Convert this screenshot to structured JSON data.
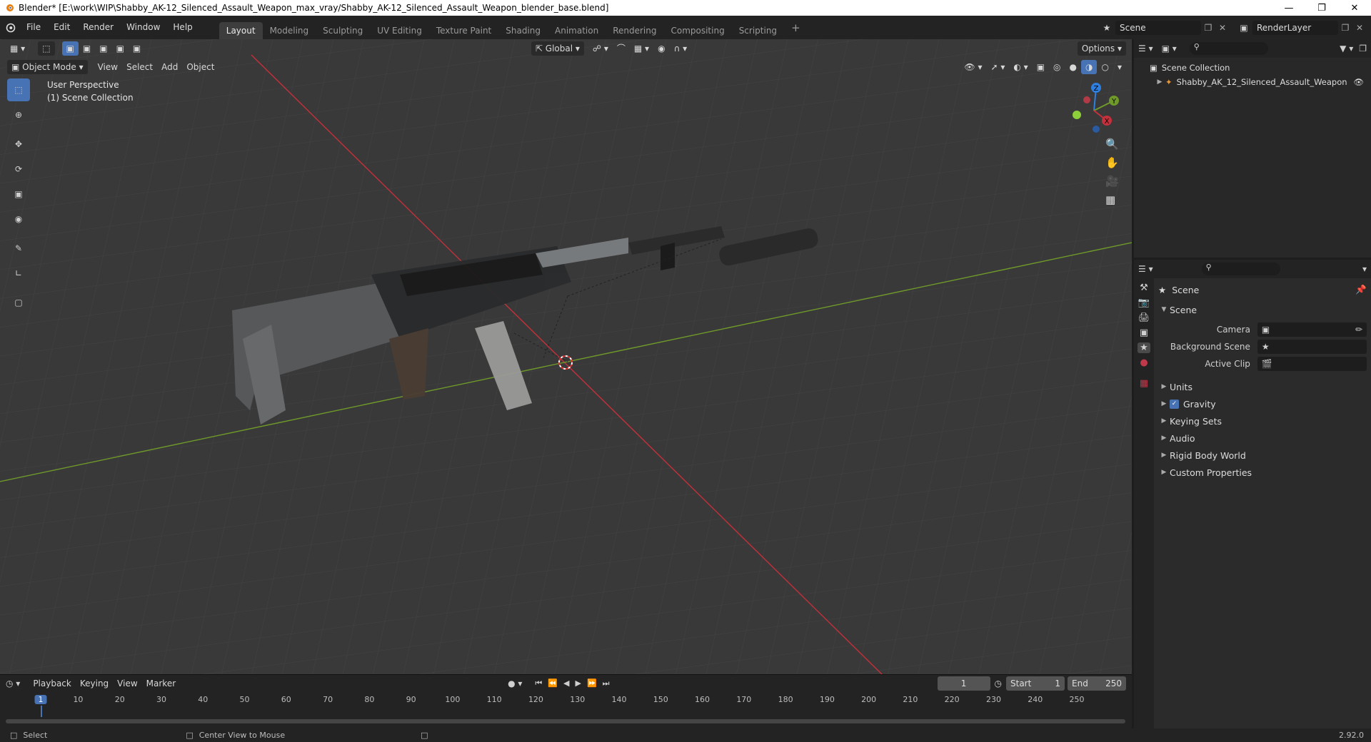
{
  "window": {
    "title": "Blender* [E:\\work\\WIP\\Shabby_AK-12_Silenced_Assault_Weapon_max_vray/Shabby_AK-12_Silenced_Assault_Weapon_blender_base.blend]"
  },
  "menu": {
    "items": [
      "File",
      "Edit",
      "Render",
      "Window",
      "Help"
    ]
  },
  "workspaces": [
    "Layout",
    "Modeling",
    "Sculpting",
    "UV Editing",
    "Texture Paint",
    "Shading",
    "Animation",
    "Rendering",
    "Compositing",
    "Scripting"
  ],
  "topright": {
    "scene": "Scene",
    "render_layer": "RenderLayer"
  },
  "viewport": {
    "transform": "Global",
    "options": "Options",
    "mode": "Object Mode",
    "menus": [
      "View",
      "Select",
      "Add",
      "Object"
    ],
    "perspective": "User Perspective",
    "collection": "(1) Scene Collection",
    "gizmo": {
      "z": "Z",
      "y": "Y",
      "x": "X"
    }
  },
  "outliner": {
    "root": "Scene Collection",
    "object": "Shabby_AK_12_Silenced_Assault_Weapon"
  },
  "properties": {
    "context": "Scene",
    "section": "Scene",
    "camera_label": "Camera",
    "background_label": "Background Scene",
    "clip_label": "Active Clip",
    "panels": [
      "Units",
      "Gravity",
      "Keying Sets",
      "Audio",
      "Rigid Body World",
      "Custom Properties"
    ]
  },
  "timeline": {
    "menus": [
      "Playback",
      "Keying",
      "View",
      "Marker"
    ],
    "current_frame": "1",
    "start_label": "Start",
    "start": "1",
    "end_label": "End",
    "end": "250",
    "ticks": [
      "1",
      "10",
      "20",
      "30",
      "40",
      "50",
      "60",
      "70",
      "80",
      "90",
      "100",
      "110",
      "120",
      "130",
      "140",
      "150",
      "160",
      "170",
      "180",
      "190",
      "200",
      "210",
      "220",
      "230",
      "240",
      "250"
    ]
  },
  "status": {
    "left": "Select",
    "middle": "Center View to Mouse",
    "version": "2.92.0"
  },
  "colors": {
    "accent": "#4772b3",
    "x_axis": "#c4303b",
    "y_axis": "#6f9a2a",
    "z_axis": "#2f7fe0"
  }
}
